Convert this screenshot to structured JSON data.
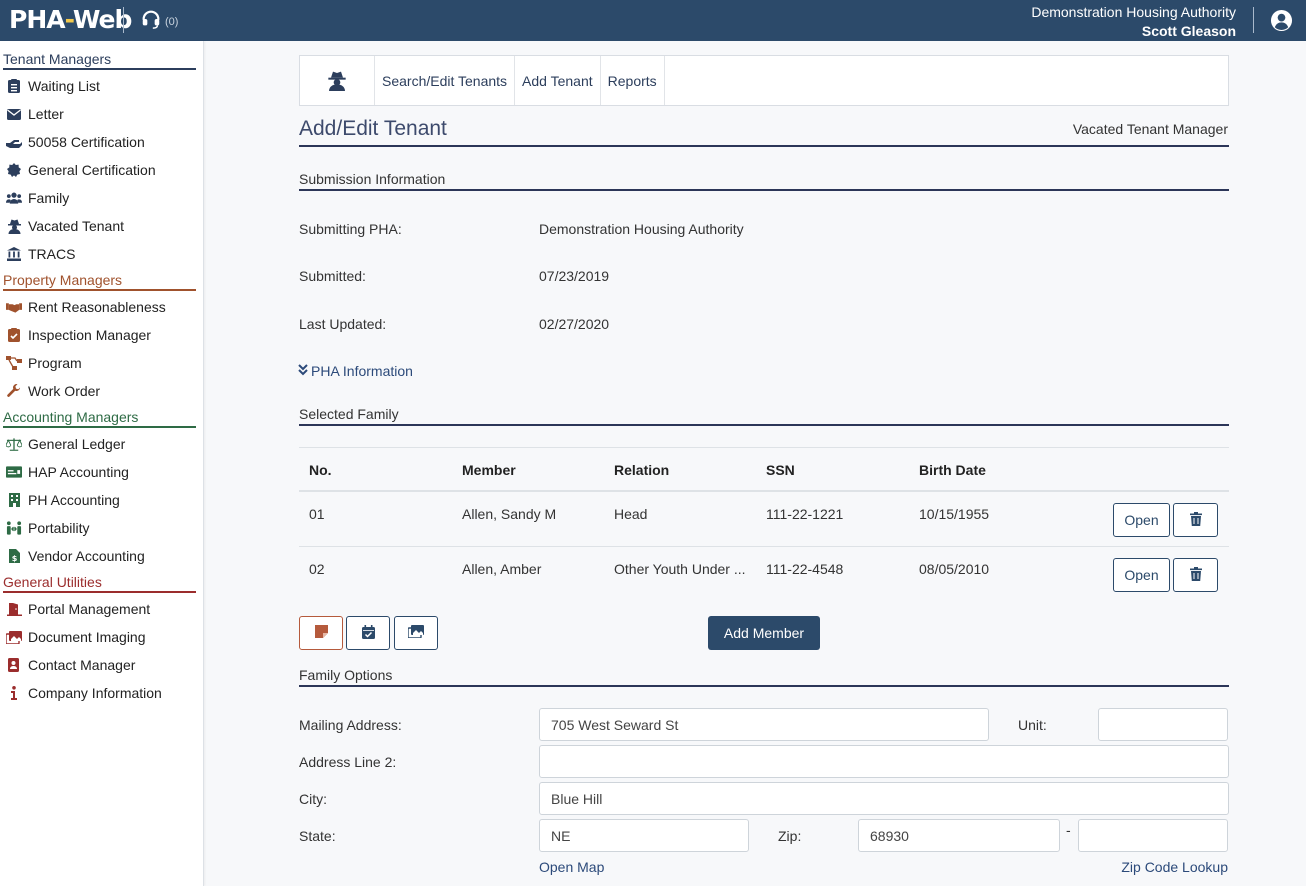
{
  "header": {
    "logo_main": "PHA",
    "logo_hyphen": "-",
    "logo_web": "Web",
    "support_count": "(0)",
    "organization": "Demonstration Housing Authority",
    "user_name": "Scott Gleason"
  },
  "sidebar": {
    "sections": [
      {
        "title": "Tenant Managers",
        "items": [
          {
            "label": "Waiting List",
            "icon": "clipboard-list-icon"
          },
          {
            "label": "Letter",
            "icon": "envelope-icon"
          },
          {
            "label": "50058 Certification",
            "icon": "hand-holding-icon"
          },
          {
            "label": "General Certification",
            "icon": "certificate-icon"
          },
          {
            "label": "Family",
            "icon": "users-icon"
          },
          {
            "label": "Vacated Tenant",
            "icon": "user-secret-icon"
          },
          {
            "label": "TRACS",
            "icon": "landmark-icon"
          }
        ]
      },
      {
        "title": "Property Managers",
        "items": [
          {
            "label": "Rent Reasonableness",
            "icon": "handshake-icon"
          },
          {
            "label": "Inspection Manager",
            "icon": "clipboard-check-icon"
          },
          {
            "label": "Program",
            "icon": "project-diagram-icon"
          },
          {
            "label": "Work Order",
            "icon": "wrench-icon"
          }
        ]
      },
      {
        "title": "Accounting Managers",
        "items": [
          {
            "label": "General Ledger",
            "icon": "balance-scale-icon"
          },
          {
            "label": "HAP Accounting",
            "icon": "money-check-icon"
          },
          {
            "label": "PH Accounting",
            "icon": "building-icon"
          },
          {
            "label": "Portability",
            "icon": "people-arrows-icon"
          },
          {
            "label": "Vendor Accounting",
            "icon": "file-invoice-dollar-icon"
          }
        ]
      },
      {
        "title": "General Utilities",
        "items": [
          {
            "label": "Portal Management",
            "icon": "door-open-icon"
          },
          {
            "label": "Document Imaging",
            "icon": "images-icon"
          },
          {
            "label": "Contact Manager",
            "icon": "address-book-icon"
          },
          {
            "label": "Company Information",
            "icon": "info-icon"
          }
        ]
      }
    ]
  },
  "toolbar": {
    "icon": "user-secret-icon",
    "links": [
      "Search/Edit Tenants",
      "Add Tenant",
      "Reports"
    ]
  },
  "page": {
    "title": "Add/Edit Tenant",
    "subtitle": "Vacated Tenant Manager"
  },
  "submission": {
    "heading": "Submission Information",
    "submitting_pha_label": "Submitting PHA:",
    "submitting_pha_value": "Demonstration Housing Authority",
    "submitted_label": "Submitted:",
    "submitted_value": "07/23/2019",
    "last_updated_label": "Last Updated:",
    "last_updated_value": "02/27/2020",
    "pha_info_link": "PHA Information"
  },
  "family": {
    "heading": "Selected Family",
    "columns": [
      "No.",
      "Member",
      "Relation",
      "SSN",
      "Birth Date"
    ],
    "rows": [
      {
        "no": "01",
        "member": "Allen, Sandy M",
        "relation": "Head",
        "ssn": "111-22-1221",
        "birth_date": "10/15/1955"
      },
      {
        "no": "02",
        "member": "Allen, Amber",
        "relation": "Other Youth Under ...",
        "ssn": "111-22-4548",
        "birth_date": "08/05/2010"
      }
    ],
    "open_label": "Open",
    "add_member_label": "Add Member"
  },
  "family_options": {
    "heading": "Family Options",
    "mailing_address_label": "Mailing Address:",
    "mailing_address_value": "705 West Seward St",
    "unit_label": "Unit:",
    "unit_value": "",
    "address2_label": "Address Line 2:",
    "address2_value": "",
    "city_label": "City:",
    "city_value": "Blue Hill",
    "state_label": "State:",
    "state_value": "NE",
    "zip_label": "Zip:",
    "zip_value": "68930",
    "zip_sep": "-",
    "zip_ext_value": "",
    "open_map_label": "Open Map",
    "zip_lookup_label": "Zip Code Lookup"
  },
  "colors": {
    "header_bg": "#2c4a6a",
    "tenant_section": "#2c3e5c",
    "property_section": "#a0522d",
    "accounting_section": "#2e6b45",
    "utilities_section": "#9b2d2d"
  }
}
